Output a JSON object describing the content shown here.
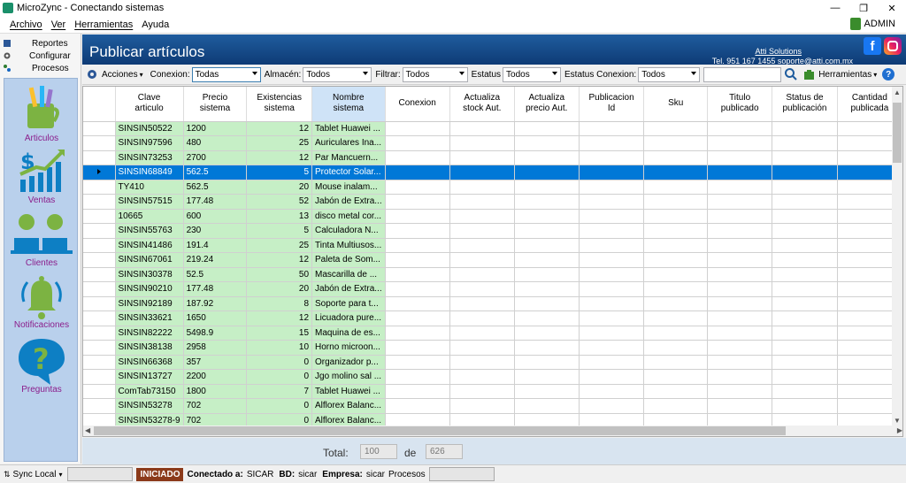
{
  "window": {
    "title": "MicroZync - Conectando sistemas",
    "user": "ADMIN",
    "colors": {
      "header": "#0e3b75",
      "selected_row": "#0078d7",
      "green_cells": "#c6efc6",
      "nav_label": "#8b1d8b"
    }
  },
  "menu": [
    "Archivo",
    "Ver",
    "Herramientas",
    "Ayuda"
  ],
  "sidebar": {
    "tabs": [
      "Reportes",
      "Configurar",
      "Procesos"
    ],
    "nav": [
      {
        "label": "Articulos",
        "icon": "articles-icon"
      },
      {
        "label": "Ventas",
        "icon": "sales-chart-icon"
      },
      {
        "label": "Clientes",
        "icon": "customers-icon"
      },
      {
        "label": "Notificaciones",
        "icon": "bell-icon"
      },
      {
        "label": "Preguntas",
        "icon": "question-icon"
      }
    ]
  },
  "header": {
    "title": "Publicar artículos",
    "company": "Atti Solutions",
    "contact": "Tel. 951 167 1455  soporte@atti.com.mx"
  },
  "toolbar": {
    "acciones": "Acciones",
    "conexion_label": "Conexion:",
    "conexion_value": "Todas",
    "almacen_label": "Almacén:",
    "almacen_value": "Todos",
    "filtrar_label": "Filtrar:",
    "filtrar_value": "Todos",
    "estatus_label": "Estatus",
    "estatus_value": "Todos",
    "estatus_conexion_label": "Estatus Conexion:",
    "estatus_conexion_value": "Todos",
    "search_value": "",
    "herramientas": "Herramientas"
  },
  "grid": {
    "columns": [
      "Clave\narticulo",
      "Precio\nsistema",
      "Existencias\nsistema",
      "Nombre\nsistema",
      "Conexion",
      "Actualiza\nstock Aut.",
      "Actualiza\nprecio Aut.",
      "Publicacion\nId",
      "Sku",
      "Titulo\npublicado",
      "Status de\npublicación",
      "Cantidad\npublicada"
    ],
    "selected_row": 3,
    "rows": [
      [
        "SINSIN50522",
        "1200",
        "12",
        "Tablet Huawei ..."
      ],
      [
        "SINSIN97596",
        "480",
        "25",
        "Auriculares Ina..."
      ],
      [
        "SINSIN73253",
        "2700",
        "12",
        "Par Mancuern..."
      ],
      [
        "SINSIN68849",
        "562.5",
        "5",
        "Protector Solar..."
      ],
      [
        "TY410",
        "562.5",
        "20",
        "Mouse inalam..."
      ],
      [
        "SINSIN57515",
        "177.48",
        "52",
        "Jabón de Extra..."
      ],
      [
        "10665",
        "600",
        "13",
        "disco metal cor..."
      ],
      [
        "SINSIN55763",
        "230",
        "5",
        "Calculadora N..."
      ],
      [
        "SINSIN41486",
        "191.4",
        "25",
        "Tinta Multiusos..."
      ],
      [
        "SINSIN67061",
        "219.24",
        "12",
        "Paleta de Som..."
      ],
      [
        "SINSIN30378",
        "52.5",
        "50",
        "Mascarilla de ..."
      ],
      [
        "SINSIN90210",
        "177.48",
        "20",
        "Jabón de Extra..."
      ],
      [
        "SINSIN92189",
        "187.92",
        "8",
        "Soporte para t..."
      ],
      [
        "SINSIN33621",
        "1650",
        "12",
        "Licuadora pure..."
      ],
      [
        "SINSIN82222",
        "5498.9",
        "15",
        "Maquina de es..."
      ],
      [
        "SINSIN38138",
        "2958",
        "10",
        "Horno microon..."
      ],
      [
        "SINSIN66368",
        "357",
        "0",
        "Organizador p..."
      ],
      [
        "SINSIN13727",
        "2200",
        "0",
        "Jgo molino sal ..."
      ],
      [
        "ComTab73150",
        "1800",
        "7",
        "Tablet Huawei ..."
      ],
      [
        "SINSIN53278",
        "702",
        "0",
        "Alflorex Balanc..."
      ],
      [
        "SINSIN53278-9",
        "702",
        "0",
        "Alflorex Balanc..."
      ]
    ]
  },
  "footer": {
    "total_label": "Total:",
    "shown": "100",
    "de_label": "de",
    "total": "626"
  },
  "status": {
    "sync": "Sync Local",
    "iniciado": "INICIADO",
    "conectado_label": "Conectado a:",
    "conectado_value": "SICAR",
    "bd_label": "BD:",
    "bd_value": "sicar",
    "empresa_label": "Empresa:",
    "empresa_value": "sicar",
    "procesos": "Procesos"
  }
}
